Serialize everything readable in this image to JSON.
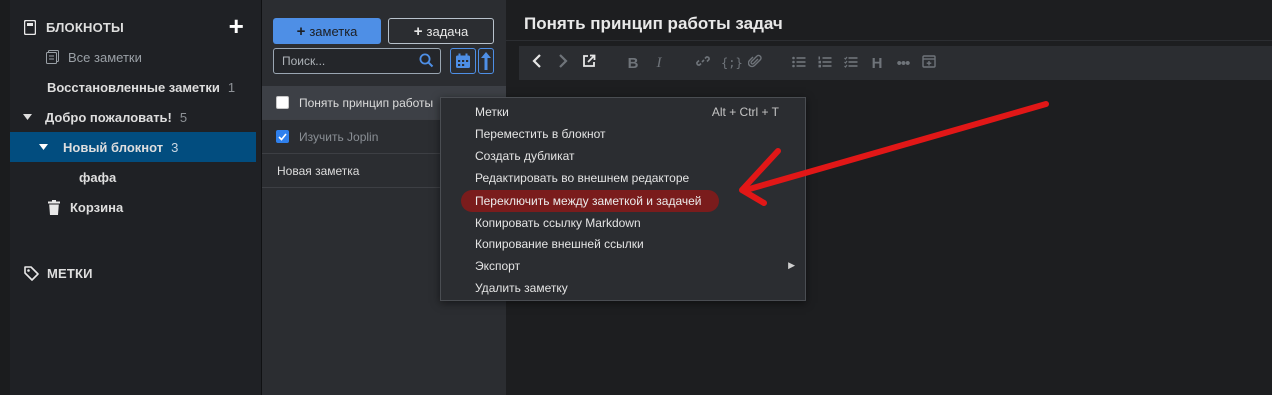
{
  "sidebar": {
    "notebooks_header": "БЛОКНОТЫ",
    "add_icon": "plus-icon",
    "all_notes": "Все заметки",
    "restored": {
      "label": "Восстановленные заметки",
      "count": "1"
    },
    "welcome": {
      "label": "Добро пожаловать!",
      "count": "5"
    },
    "new_notebook": {
      "label": "Новый блокнот",
      "count": "3"
    },
    "child": "фафа",
    "trash": "Корзина",
    "tags_header": "МЕТКИ"
  },
  "notelist": {
    "new_note": "заметка",
    "new_task": "задача",
    "search_placeholder": "Поиск...",
    "notes": [
      {
        "title": "Понять принцип работы",
        "checked": false
      },
      {
        "title": "Изучить Joplin",
        "checked": true
      },
      {
        "title": "Новая заметка"
      }
    ]
  },
  "editor": {
    "title": "Понять принцип работы задач"
  },
  "context_menu": {
    "items": [
      "Метки",
      "Переместить в блокнот",
      "Создать дубликат",
      "Редактировать во внешнем редакторе",
      "Переключить между заметкой и задачей",
      "Копировать ссылку Markdown",
      "Копирование внешней ссылки",
      "Экспорт",
      "Удалить заметку"
    ],
    "shortcut": "Alt + Ctrl + T",
    "highlight_color": "#7a1c1c"
  },
  "colors": {
    "accent": "#4e8fe6",
    "selected_notebook": "#024d7f",
    "annotation_arrow": "#e11717"
  }
}
